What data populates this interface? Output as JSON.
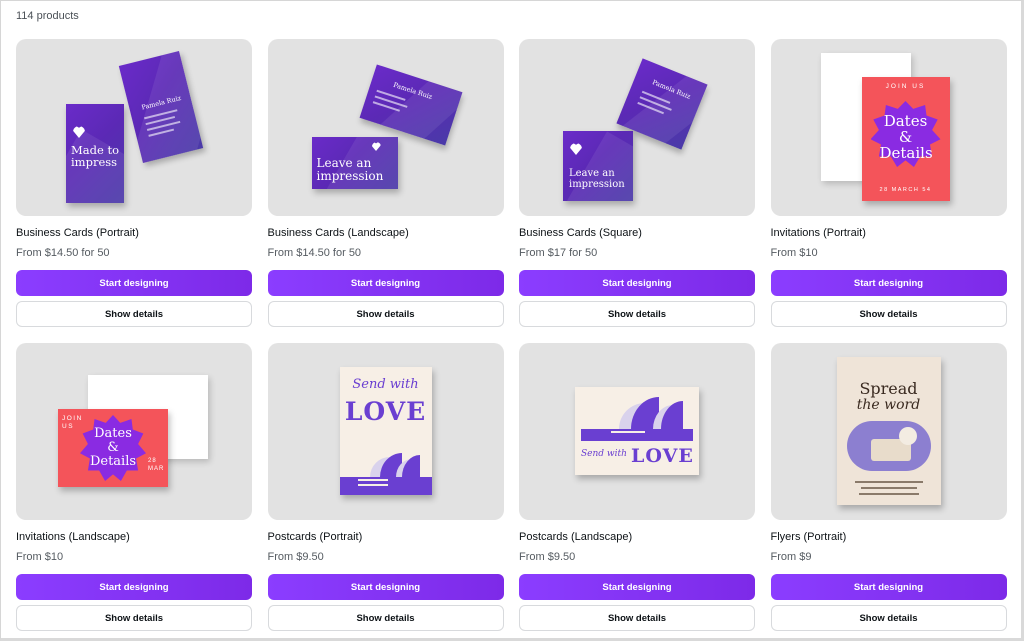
{
  "header": {
    "count_label": "114 products"
  },
  "colors": {
    "accent": "#8b3dff",
    "card_bg": "#e2e2e2"
  },
  "common": {
    "start_label": "Start designing",
    "details_label": "Show details"
  },
  "products": [
    {
      "name": "Business Cards (Portrait)",
      "price": "From $14.50 for 50",
      "art": {
        "front_text": "Made to impress",
        "back_name": "Pamela Ruiz",
        "icon": "heart-icon"
      }
    },
    {
      "name": "Business Cards (Landscape)",
      "price": "From $14.50 for 50",
      "art": {
        "front_text": "Leave an impression",
        "back_name": "Pamela Ruiz",
        "icon": "heart-icon"
      }
    },
    {
      "name": "Business Cards (Square)",
      "price": "From $17 for 50",
      "art": {
        "front_text": "Leave an impression",
        "back_name": "Pamela Ruiz",
        "icon": "heart-icon"
      }
    },
    {
      "name": "Invitations (Portrait)",
      "price": "From $10",
      "art": {
        "top": "JOIN US",
        "headline": "Dates & Details",
        "date": "28 MARCH 54"
      }
    },
    {
      "name": "Invitations (Landscape)",
      "price": "From $10",
      "art": {
        "top": "JOIN US",
        "headline": "Dates & Details",
        "date": "28 MAR"
      }
    },
    {
      "name": "Postcards (Portrait)",
      "price": "From $9.50",
      "art": {
        "script": "Send with",
        "headline": "LOVE"
      }
    },
    {
      "name": "Postcards (Landscape)",
      "price": "From $9.50",
      "art": {
        "script": "Send with",
        "headline": "LOVE"
      }
    },
    {
      "name": "Flyers (Portrait)",
      "price": "From $9",
      "art": {
        "line1": "Spread",
        "line2": "the word"
      }
    }
  ]
}
